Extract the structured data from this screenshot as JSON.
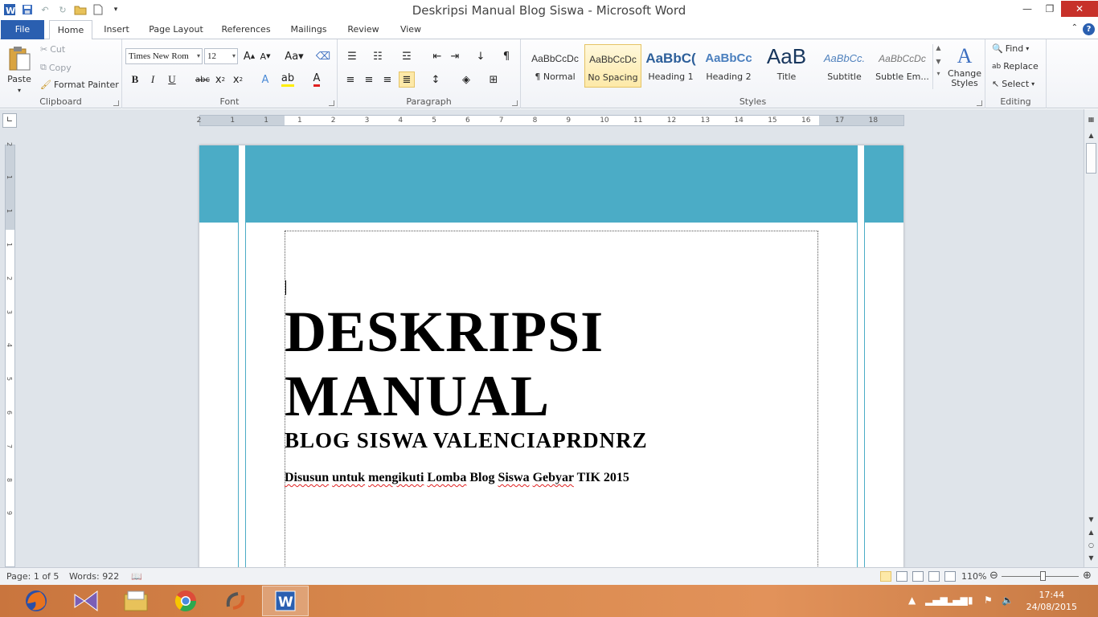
{
  "window": {
    "title": "Deskripsi Manual Blog Siswa  -  Microsoft Word"
  },
  "tabs": [
    "File",
    "Home",
    "Insert",
    "Page Layout",
    "References",
    "Mailings",
    "Review",
    "View"
  ],
  "clipboard": {
    "paste": "Paste",
    "cut": "Cut",
    "copy": "Copy",
    "format_painter": "Format Painter",
    "label": "Clipboard"
  },
  "font": {
    "name": "Times New Rom",
    "size": "12",
    "label": "Font"
  },
  "paragraph": {
    "label": "Paragraph"
  },
  "styles": {
    "label": "Styles",
    "items": [
      {
        "preview": "AaBbCcDc",
        "name": "¶ Normal"
      },
      {
        "preview": "AaBbCcDc",
        "name": "No Spacing"
      },
      {
        "preview": "AaBbC(",
        "name": "Heading 1"
      },
      {
        "preview": "AaBbCc",
        "name": "Heading 2"
      },
      {
        "preview": "AaB",
        "name": "Title"
      },
      {
        "preview": "AaBbCc.",
        "name": "Subtitle"
      },
      {
        "preview": "AaBbCcDc",
        "name": "Subtle Em..."
      }
    ],
    "change_styles": "Change Styles"
  },
  "editing": {
    "find": "Find",
    "replace": "Replace",
    "select": "Select",
    "label": "Editing"
  },
  "ruler": {
    "ticks": [
      "2",
      "1",
      "1",
      "1",
      "2",
      "3",
      "4",
      "5",
      "6",
      "7",
      "8",
      "9",
      "10",
      "11",
      "12",
      "13",
      "14",
      "15",
      "16",
      "17",
      "18"
    ]
  },
  "vruler": {
    "ticks": [
      "2",
      "1",
      "1",
      "1",
      "2",
      "3",
      "4",
      "5",
      "6",
      "7",
      "8",
      "9"
    ]
  },
  "document": {
    "title_line1": "DESKRIPSI",
    "title_line2": "MANUAL",
    "subtitle": "BLOG SISWA VALENCIAPRDNRZ",
    "note_words": [
      "Disusun",
      "untuk",
      "mengikuti",
      "Lomba",
      "Blog",
      "Siswa",
      "Gebyar",
      "TIK 2015"
    ]
  },
  "status": {
    "page": "Page: 1 of 5",
    "words": "Words: 922",
    "zoom": "110%",
    "zoom_level_percent": 110
  },
  "clock": {
    "time": "17:44",
    "date": "24/08/2015"
  },
  "colors": {
    "band": "#4bacc6",
    "file_tab": "#2a5fb0",
    "close": "#c7312a"
  }
}
